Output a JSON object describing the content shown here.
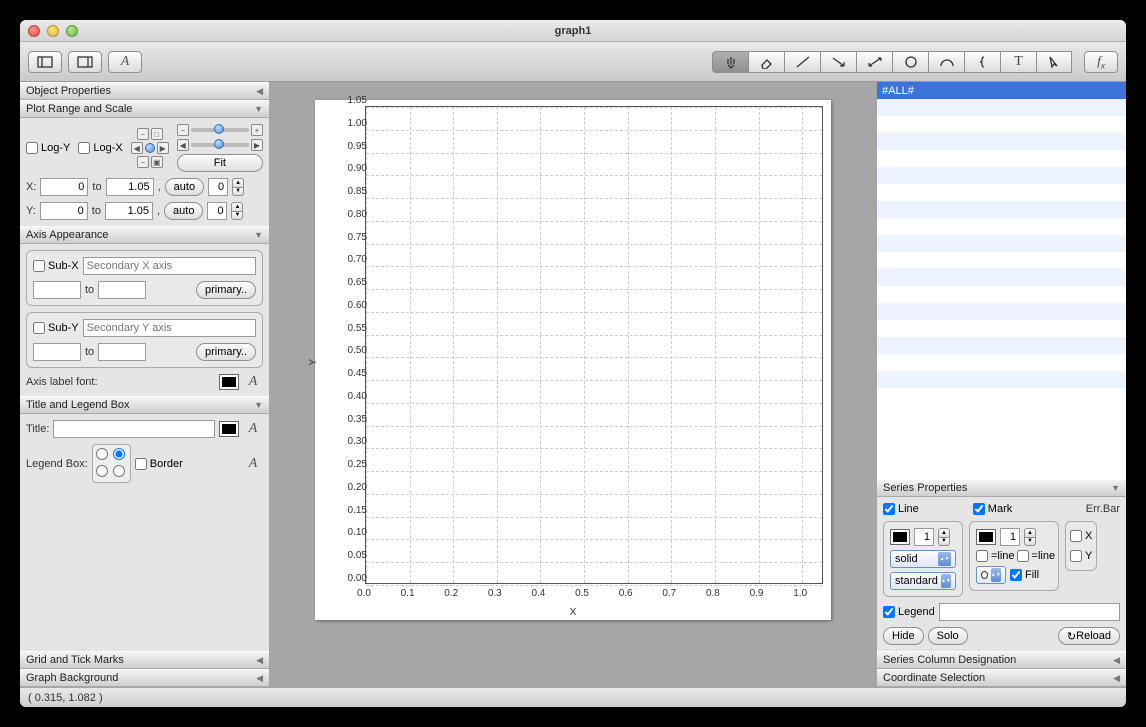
{
  "window": {
    "title": "graph1"
  },
  "status": {
    "coords": "( 0.315,  1.082 )"
  },
  "sections": {
    "obj_props": "Object Properties",
    "plot_range": "Plot Range and Scale",
    "axis_app": "Axis Appearance",
    "title_legend": "Title and Legend Box",
    "grid_ticks": "Grid and Tick Marks",
    "graph_bg": "Graph Background",
    "series_props": "Series Properties",
    "series_col": "Series Column Designation",
    "coord_sel": "Coordinate Selection"
  },
  "plot_range": {
    "logy": "Log-Y",
    "logx": "Log-X",
    "fit": "Fit",
    "x_label": "X:",
    "y_label": "Y:",
    "to": "to",
    "comma": ",",
    "auto": "auto",
    "x_from": "0",
    "x_to": "1.05",
    "x_step": "0",
    "y_from": "0",
    "y_to": "1.05",
    "y_step": "0"
  },
  "axis_app": {
    "subx": "Sub-X",
    "suby": "Sub-Y",
    "ph_x": "Secondary X axis",
    "ph_y": "Secondary Y axis",
    "to": "to",
    "primary": "primary..",
    "label_font": "Axis label font:"
  },
  "title_legend": {
    "title_label": "Title:",
    "legend_label": "Legend Box:",
    "border": "Border"
  },
  "series_list": {
    "all": "#ALL#"
  },
  "series_props": {
    "line": "Line",
    "mark": "Mark",
    "errbar": "Err.Bar",
    "width1": "1",
    "width2": "1",
    "solid": "solid",
    "standard": "standard",
    "eqline1": "=line",
    "eqline2": "=line",
    "fill": "Fill",
    "x": "X",
    "y": "Y",
    "legend": "Legend",
    "hide": "Hide",
    "solo": "Solo",
    "reload": "Reload"
  },
  "chart_data": {
    "type": "scatter",
    "series": [],
    "xlabel": "X",
    "ylabel": "Y",
    "xlim": [
      0,
      1.05
    ],
    "ylim": [
      0,
      1.05
    ],
    "xticks": [
      0.0,
      0.1,
      0.2,
      0.3,
      0.4,
      0.5,
      0.6,
      0.7,
      0.8,
      0.9,
      1.0
    ],
    "yticks": [
      0.0,
      0.05,
      0.1,
      0.15,
      0.2,
      0.25,
      0.3,
      0.35,
      0.4,
      0.45,
      0.5,
      0.55,
      0.6,
      0.65,
      0.7,
      0.75,
      0.8,
      0.85,
      0.9,
      0.95,
      1.0,
      1.05
    ]
  }
}
